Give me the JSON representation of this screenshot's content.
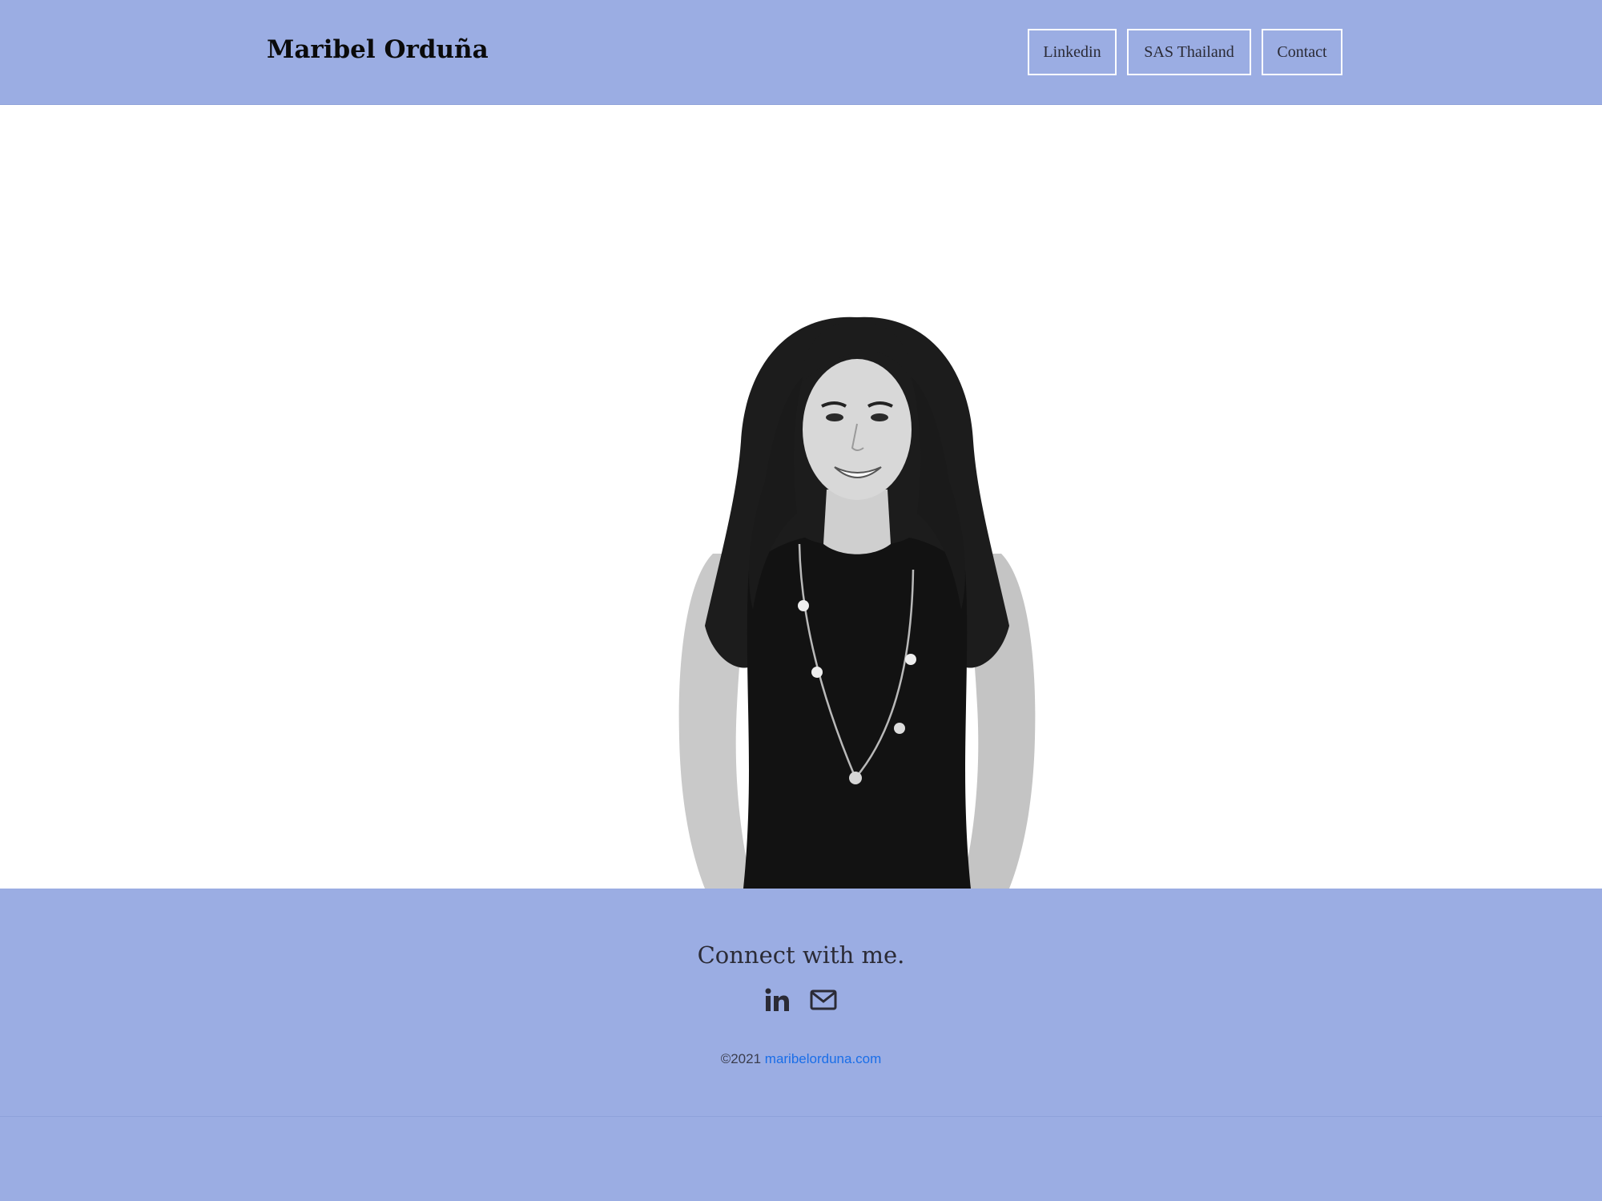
{
  "header": {
    "site_title": "Maribel Orduña",
    "nav": [
      {
        "label": "Linkedin"
      },
      {
        "label": "SAS Thailand"
      },
      {
        "label": "Contact"
      }
    ]
  },
  "hero": {
    "image_alt": "Black and white portrait of a smiling woman with long wavy hair wearing a sleeveless black top and a long beaded necklace"
  },
  "footer": {
    "heading": "Connect with me.",
    "social": [
      {
        "icon": "linkedin-icon"
      },
      {
        "icon": "mail-icon"
      }
    ],
    "copyright_prefix": "©2021",
    "copyright_link": "maribelorduna.com"
  },
  "colors": {
    "band": "#9bade3",
    "hero_bg": "#ffffff",
    "link": "#1a6ee8",
    "nav_border": "#ffffff"
  }
}
